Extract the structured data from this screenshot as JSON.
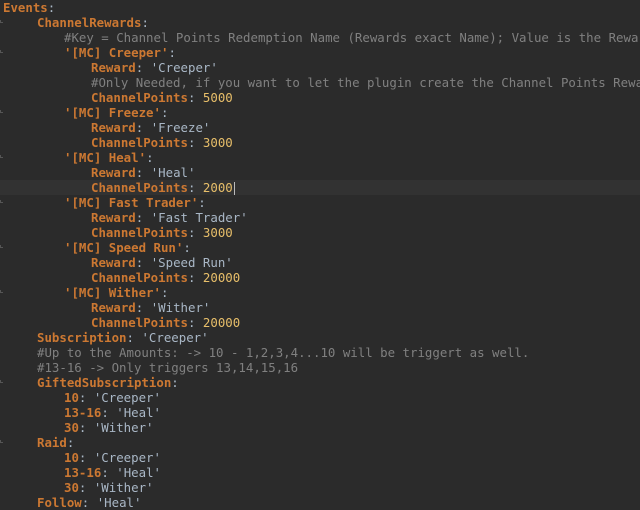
{
  "editor": {
    "lines": [
      {
        "key": "Events",
        "sep": ":"
      },
      {
        "key": "ChannelRewards",
        "sep": ":"
      },
      {
        "comment": "#Key = Channel Points Redemption Name (Rewards exact Name); Value is the Reward"
      },
      {
        "key": "'[MC] Creeper'",
        "sep": ":"
      },
      {
        "key": "Reward",
        "sep": ": ",
        "value": "'Creeper'"
      },
      {
        "comment": "#Only Needed, if you want to let the plugin create the Channel Points Reward"
      },
      {
        "key": "ChannelPoints",
        "sep": ": ",
        "number": "5000"
      },
      {
        "key": "'[MC] Freeze'",
        "sep": ":"
      },
      {
        "key": "Reward",
        "sep": ": ",
        "value": "'Freeze'"
      },
      {
        "key": "ChannelPoints",
        "sep": ": ",
        "number": "3000"
      },
      {
        "key": "'[MC] Heal'",
        "sep": ":"
      },
      {
        "key": "Reward",
        "sep": ": ",
        "value": "'Heal'"
      },
      {
        "key": "ChannelPoints",
        "sep": ": ",
        "number": "2000"
      },
      {
        "key": "'[MC] Fast Trader'",
        "sep": ":"
      },
      {
        "key": "Reward",
        "sep": ": ",
        "value": "'Fast Trader'"
      },
      {
        "key": "ChannelPoints",
        "sep": ": ",
        "number": "3000"
      },
      {
        "key": "'[MC] Speed Run'",
        "sep": ":"
      },
      {
        "key": "Reward",
        "sep": ": ",
        "value": "'Speed Run'"
      },
      {
        "key": "ChannelPoints",
        "sep": ": ",
        "number": "20000"
      },
      {
        "key": "'[MC] Wither'",
        "sep": ":"
      },
      {
        "key": "Reward",
        "sep": ": ",
        "value": "'Wither'"
      },
      {
        "key": "ChannelPoints",
        "sep": ": ",
        "number": "20000"
      },
      {
        "key": "Subscription",
        "sep": ": ",
        "value": "'Creeper'"
      },
      {
        "comment": "#Up to the Amounts: -> 10 - 1,2,3,4...10 will be triggert as well."
      },
      {
        "comment": "#13-16 -> Only triggers 13,14,15,16"
      },
      {
        "key": "GiftedSubscription",
        "sep": ":"
      },
      {
        "key": "10",
        "sep": ": ",
        "value": "'Creeper'"
      },
      {
        "key": "13-16",
        "sep": ": ",
        "value": "'Heal'"
      },
      {
        "key": "30",
        "sep": ": ",
        "value": "'Wither'"
      },
      {
        "key": "Raid",
        "sep": ":"
      },
      {
        "key": "10",
        "sep": ": ",
        "value": "'Creeper'"
      },
      {
        "key": "13-16",
        "sep": ": ",
        "value": "'Heal'"
      },
      {
        "key": "30",
        "sep": ": ",
        "value": "'Wither'"
      },
      {
        "key": "Follow",
        "sep": ": ",
        "value": "'Heal'"
      }
    ]
  }
}
